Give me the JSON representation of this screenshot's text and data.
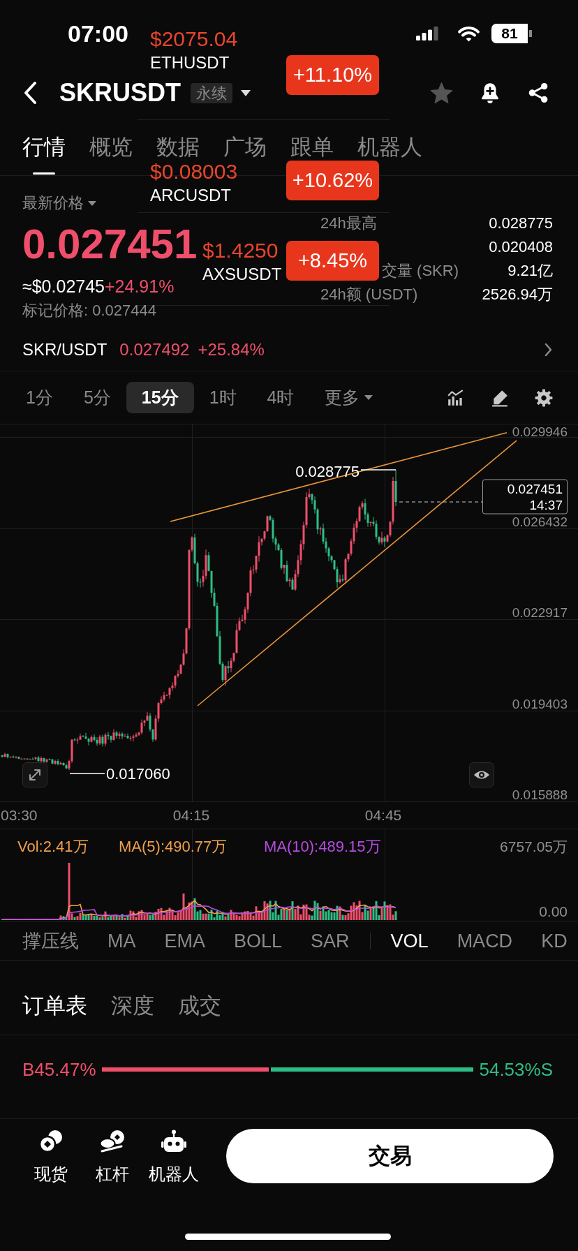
{
  "status_bar": {
    "time": "07:00",
    "battery": "81"
  },
  "ticker_overlay": [
    {
      "price": "$2075.04",
      "pair": "ETHUSDT",
      "change": "+11.10%"
    },
    {
      "price": "$0.08003",
      "pair": "ARCUSDT",
      "change": "+10.62%"
    },
    {
      "price": "$1.4250",
      "pair": "AXSUSDT",
      "change": "+8.45%"
    }
  ],
  "header": {
    "title": "SKRUSDT",
    "tag": "永续",
    "starred": false
  },
  "tabs": [
    {
      "label": "行情",
      "selected": true
    },
    {
      "label": "概览",
      "selected": false
    },
    {
      "label": "数据",
      "selected": false
    },
    {
      "label": "广场",
      "selected": false
    },
    {
      "label": "跟单",
      "selected": false
    },
    {
      "label": "机器人",
      "selected": false
    }
  ],
  "price_panel": {
    "label": "最新价格",
    "last_price": "0.027451",
    "fiat_price": "≈$0.02745",
    "change": "+24.91%",
    "mark_price": "标记价格: 0.027444"
  },
  "stats": [
    {
      "kind": "stat",
      "label": "24h最高",
      "value": "0.028775"
    },
    {
      "kind": "covered",
      "value": "0.020408"
    },
    {
      "kind": "partly-covered",
      "label": "交量 (SKR)",
      "value": "9.21亿"
    },
    {
      "kind": "stat",
      "label": "24h额 (USDT)",
      "value": "2526.94万"
    }
  ],
  "spot_market": {
    "pair": "SKR/USDT",
    "price": "0.027492",
    "change": "+25.84%"
  },
  "intervals": [
    {
      "kind": "interval",
      "label": "1分",
      "selected": false
    },
    {
      "kind": "interval",
      "label": "5分",
      "selected": false
    },
    {
      "kind": "interval",
      "label": "15分",
      "selected": true
    },
    {
      "kind": "interval",
      "label": "1时",
      "selected": false
    },
    {
      "kind": "interval",
      "label": "4时",
      "selected": false
    },
    {
      "kind": "menu",
      "label": "更多",
      "selected": false
    }
  ],
  "chart": {
    "price_labels": [
      "0.029946",
      "0.026432",
      "0.022917",
      "0.019403",
      "0.015888"
    ],
    "time_labels": [
      "03:30",
      "04:15",
      "04:45"
    ],
    "high_label": "0.028775",
    "low_label": "0.017060",
    "last_price": "0.027451",
    "countdown": "14:37"
  },
  "volume": {
    "vol": "Vol:2.41万",
    "ma5": "MA(5):490.77万",
    "ma10": "MA(10):489.15万",
    "max_label": "6757.05万",
    "min_label": "0.00"
  },
  "main_indicators": [
    {
      "label": "撑压线",
      "selected": false
    },
    {
      "label": "MA",
      "selected": false
    },
    {
      "label": "EMA",
      "selected": false
    },
    {
      "label": "BOLL",
      "selected": false
    },
    {
      "label": "SAR",
      "selected": false
    }
  ],
  "sub_indicators": [
    {
      "label": "VOL",
      "selected": true
    },
    {
      "label": "MACD",
      "selected": false
    },
    {
      "label": "KD",
      "selected": false
    }
  ],
  "order_tabs": [
    {
      "label": "订单表",
      "selected": true
    },
    {
      "label": "深度",
      "selected": false
    },
    {
      "label": "成交",
      "selected": false
    }
  ],
  "order_ratio": {
    "buy": "B45.47%",
    "sell": "54.53%S",
    "level": 0.4547
  },
  "bottom_nav": [
    {
      "label": "现货"
    },
    {
      "label": "杠杆"
    },
    {
      "label": "机器人"
    }
  ],
  "trade_button": "交易"
}
